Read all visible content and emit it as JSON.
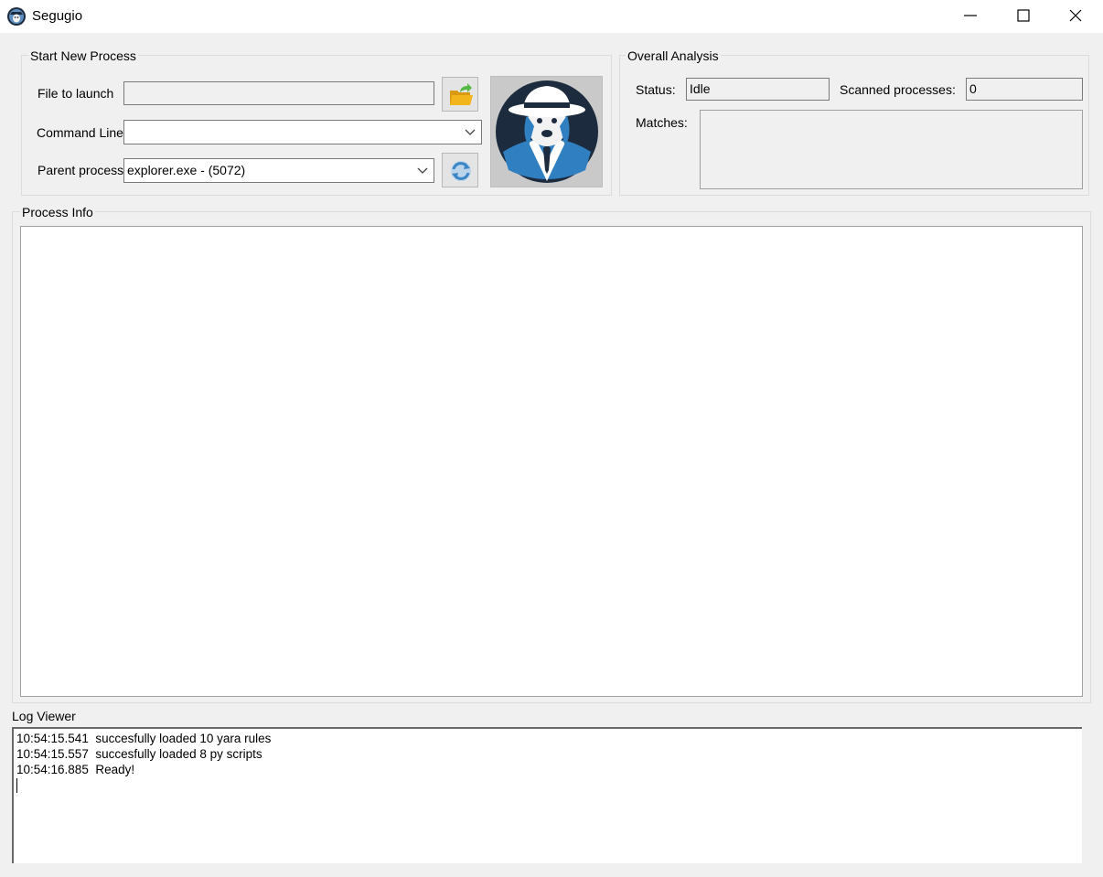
{
  "window": {
    "title": "Segugio",
    "icon": "segugio-dog-icon",
    "controls": [
      "minimize-icon",
      "maximize-icon",
      "close-icon"
    ]
  },
  "start_process": {
    "group_title": "Start New Process",
    "file_to_launch_label": "File to launch",
    "file_to_launch_value": "",
    "command_line_label": "Command Line",
    "command_line_value": "",
    "parent_process_label": "Parent process",
    "parent_process_value": "explorer.exe - (5072)",
    "browse_button_icon": "open-folder-icon",
    "refresh_button_icon": "refresh-icon",
    "logo": "detective-dog-logo"
  },
  "overall_analysis": {
    "group_title": "Overall Analysis",
    "status_label": "Status:",
    "status_value": "Idle",
    "scanned_label": "Scanned processes:",
    "scanned_value": "0",
    "matches_label": "Matches:",
    "matches_value": ""
  },
  "process_info": {
    "group_title": "Process Info"
  },
  "log_viewer": {
    "title": "Log Viewer",
    "lines": [
      "10:54:15.541  succesfully loaded 10 yara rules",
      "10:54:15.557  succesfully loaded 8 py scripts",
      "10:54:16.885  Ready!"
    ]
  },
  "colors": {
    "window_bg": "#f0f0f0",
    "titlebar_bg": "#ffffff",
    "logo_blue": "#2f7fc1",
    "logo_dark": "#1c2b3d",
    "folder_yellow": "#f3b51c",
    "arrow_green": "#58b847"
  }
}
